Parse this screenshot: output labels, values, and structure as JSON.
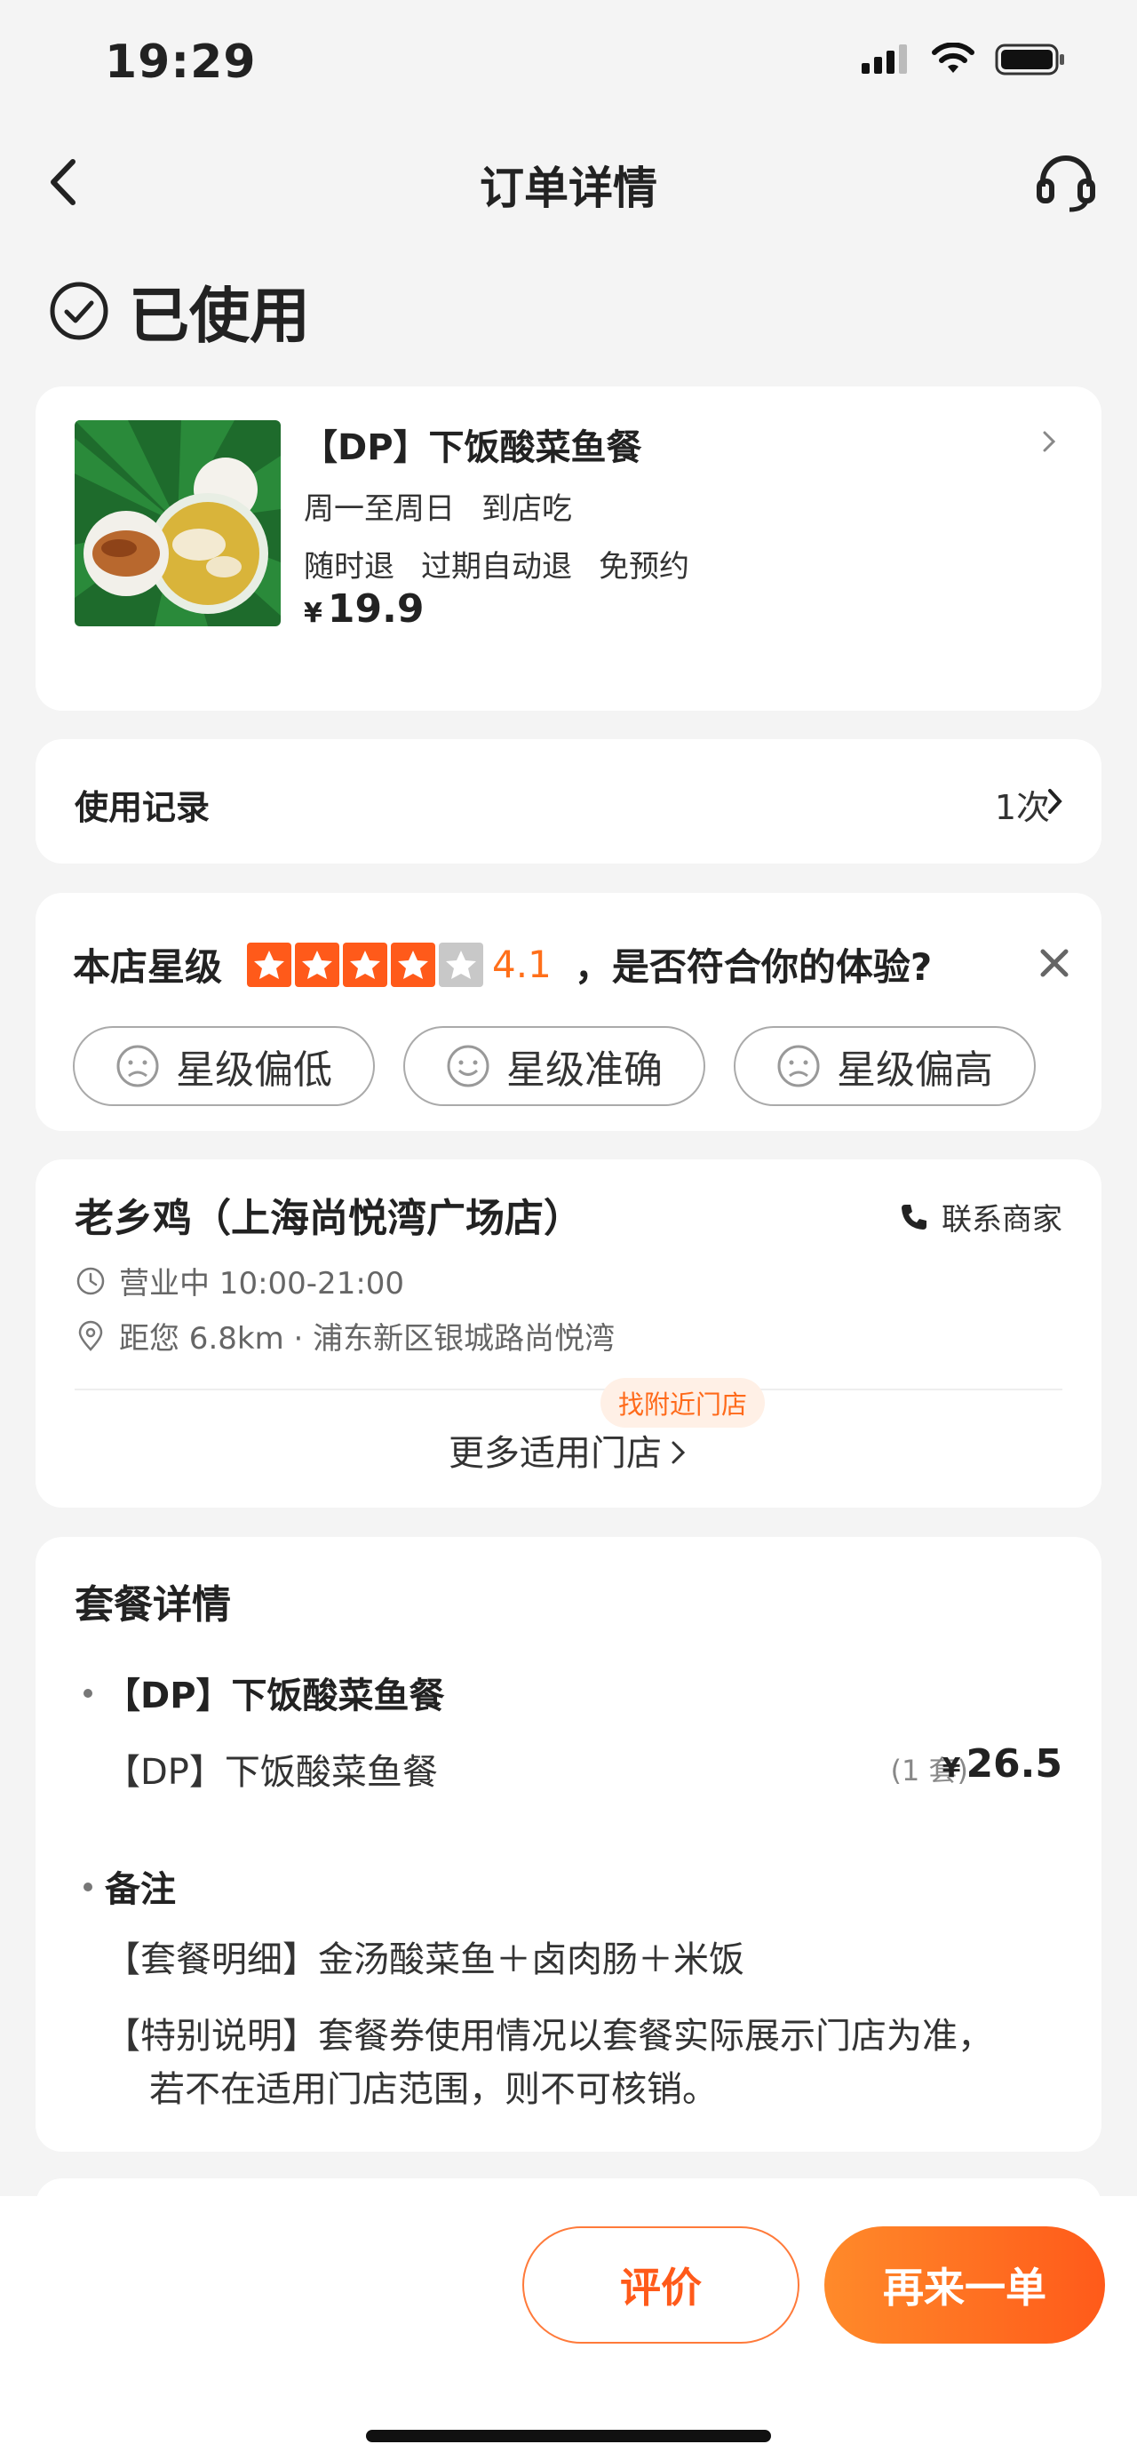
{
  "status_bar": {
    "time": "19:29"
  },
  "nav": {
    "title": "订单详情"
  },
  "order_status": "已使用",
  "product": {
    "title": "【DP】下饭酸菜鱼餐",
    "line1": [
      "周一至周日",
      "到店吃"
    ],
    "line2": [
      "随时退",
      "过期自动退",
      "免预约"
    ],
    "currency": "¥",
    "price": "19.9"
  },
  "usage": {
    "label": "使用记录",
    "value": "1次"
  },
  "rating": {
    "label": "本店星级",
    "score": "4.1",
    "stars": 4.1,
    "question": "，是否符合你的体验?",
    "options": [
      "星级偏低",
      "星级准确",
      "星级偏高"
    ]
  },
  "store": {
    "name": "老乡鸡（上海尚悦湾广场店）",
    "contact": "联系商家",
    "hours": "营业中 10:00-21:00",
    "distance": "距您 6.8km · 浦东新区银城路尚悦湾",
    "nearby_tag": "找附近门店",
    "more": "更多适用门店"
  },
  "detail": {
    "title": "套餐详情",
    "item_name": "【DP】下饭酸菜鱼餐",
    "sub_name": "【DP】下饭酸菜鱼餐",
    "qty": "(1 套)",
    "currency": "¥",
    "price": "26.5",
    "note_title": "备注",
    "note1": "【套餐明细】金汤酸菜鱼＋卤肉肠＋米饭",
    "note2a": "【特别说明】套餐券使用情况以套餐实际展示门店为准，",
    "note2b": "若不在适用门店范围，则不可核销。"
  },
  "actions": {
    "review": "评价",
    "reorder": "再来一单"
  },
  "colors": {
    "accent": "#ff6a1a",
    "star": "#ff5a1a"
  }
}
